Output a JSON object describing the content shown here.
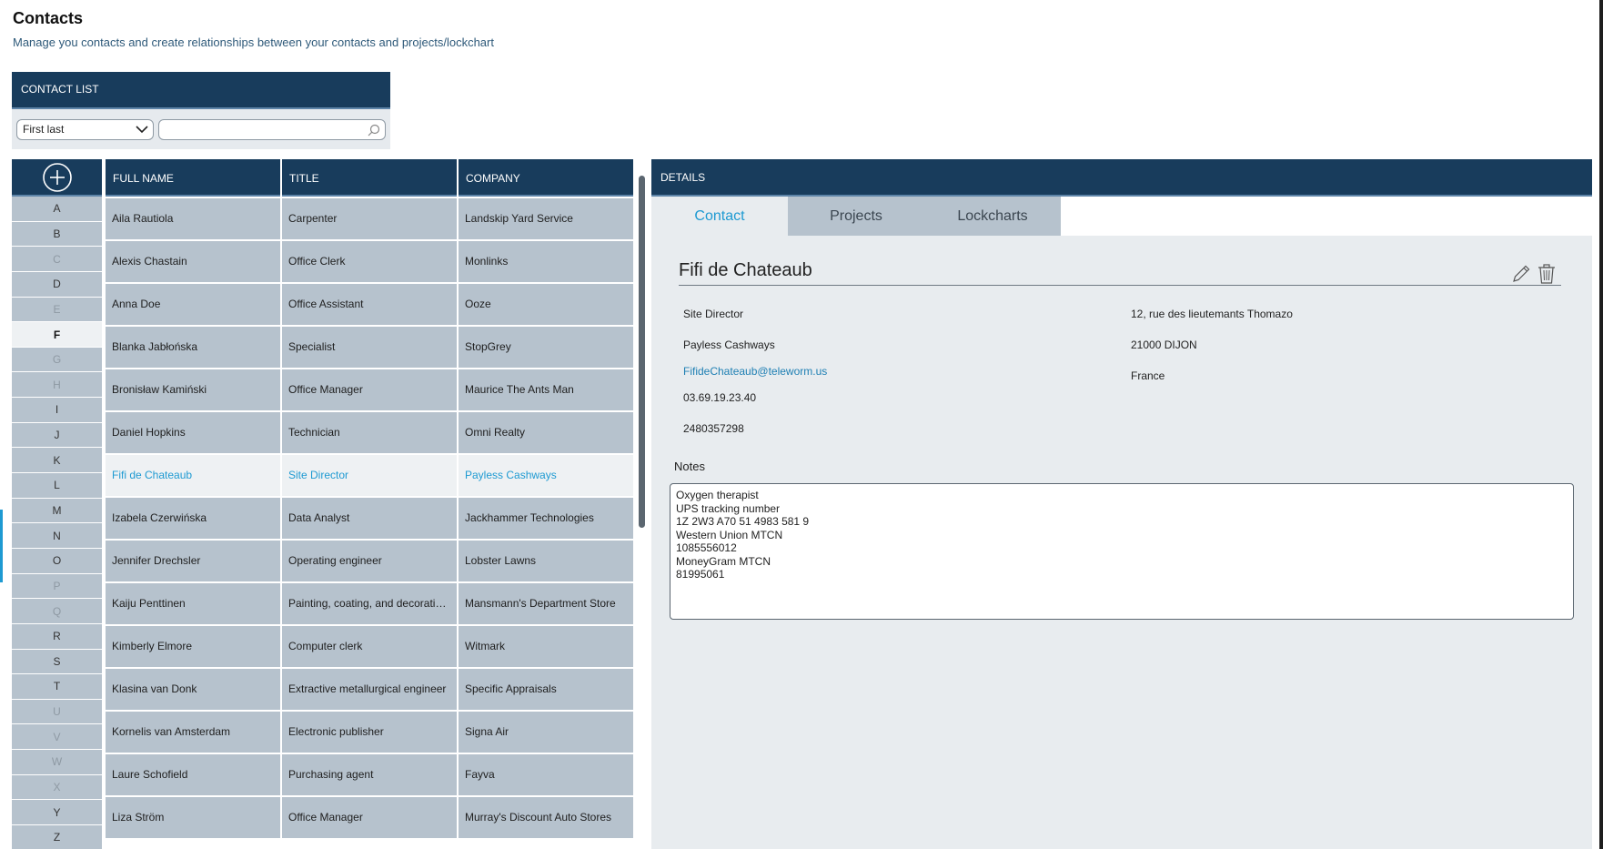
{
  "page": {
    "title": "Contacts",
    "subtitle": "Manage you contacts and create relationships between your contacts and projects/lockchart"
  },
  "contact_list": {
    "header": "CONTACT LIST",
    "sort_select": "First last",
    "search_value": "",
    "add_icon": "plus-circle-icon",
    "letters": [
      "A",
      "B",
      "C",
      "D",
      "E",
      "F",
      "G",
      "H",
      "I",
      "J",
      "K",
      "L",
      "M",
      "N",
      "O",
      "P",
      "Q",
      "R",
      "S",
      "T",
      "U",
      "V",
      "W",
      "X",
      "Y",
      "Z"
    ],
    "dim_letters": [
      "C",
      "E",
      "G",
      "H",
      "P",
      "Q",
      "U",
      "V",
      "W",
      "X"
    ],
    "active_letter": "F",
    "columns": [
      "FULL NAME",
      "TITLE",
      "COMPANY"
    ],
    "rows": [
      {
        "name": "Aila Rautiola",
        "title": "Carpenter",
        "company": "Landskip Yard Service"
      },
      {
        "name": "Alexis  Chastain",
        "title": "Office Clerk",
        "company": "Monlinks"
      },
      {
        "name": "Anna Doe",
        "title": "Office Assistant",
        "company": "Ooze"
      },
      {
        "name": "Blanka Jabłońska",
        "title": "Specialist",
        "company": "StopGrey"
      },
      {
        "name": "Bronisław Kamiński",
        "title": "Office Manager",
        "company": "Maurice The Ants Man"
      },
      {
        "name": "Daniel Hopkins",
        "title": "Technician",
        "company": "Omni Realty"
      },
      {
        "name": "Fifi de Chateaub",
        "title": "Site Director",
        "company": "Payless Cashways"
      },
      {
        "name": "Izabela Czerwińska",
        "title": "Data Analyst",
        "company": "Jackhammer Technologies"
      },
      {
        "name": "Jennifer Drechsler",
        "title": "Operating engineer",
        "company": "Lobster Lawns"
      },
      {
        "name": "Kaiju Penttinen",
        "title": "Painting, coating, and decorating workers",
        "company": "Mansmann's Department Store"
      },
      {
        "name": "Kimberly Elmore",
        "title": "Computer clerk",
        "company": "Witmark"
      },
      {
        "name": "Klasina van Donk",
        "title": "Extractive metallurgical engineer",
        "company": "Specific Appraisals"
      },
      {
        "name": "Kornelis van Amsterdam",
        "title": "Electronic publisher",
        "company": "Signa Air"
      },
      {
        "name": "Laure Schofield",
        "title": "Purchasing agent",
        "company": "Fayva"
      },
      {
        "name": "Liza Ström",
        "title": "Office Manager",
        "company": "Murray's Discount Auto Stores"
      }
    ],
    "selected_row": 6
  },
  "details": {
    "header": "DETAILS",
    "tabs": [
      "Contact",
      "Projects",
      "Lockcharts"
    ],
    "active_tab": 0,
    "name": "Fifi de Chateaub",
    "left_fields": {
      "title": "Site Director",
      "company": "Payless Cashways",
      "email": "FifideChateaub@teleworm.us",
      "phone": "03.69.19.23.40",
      "mobile": "2480357298"
    },
    "right_fields": {
      "street": "12, rue des lieutemants Thomazo",
      "city": "21000 DIJON",
      "country": "France"
    },
    "notes_label": "Notes",
    "notes": [
      "Oxygen therapist",
      "UPS tracking number",
      "1Z 2W3 A70 51 4983 581 9",
      "Western Union MTCN",
      "1085556012",
      "MoneyGram MTCN",
      "81995061"
    ],
    "edit_icon": "pencil-icon",
    "delete_icon": "trash-icon"
  }
}
